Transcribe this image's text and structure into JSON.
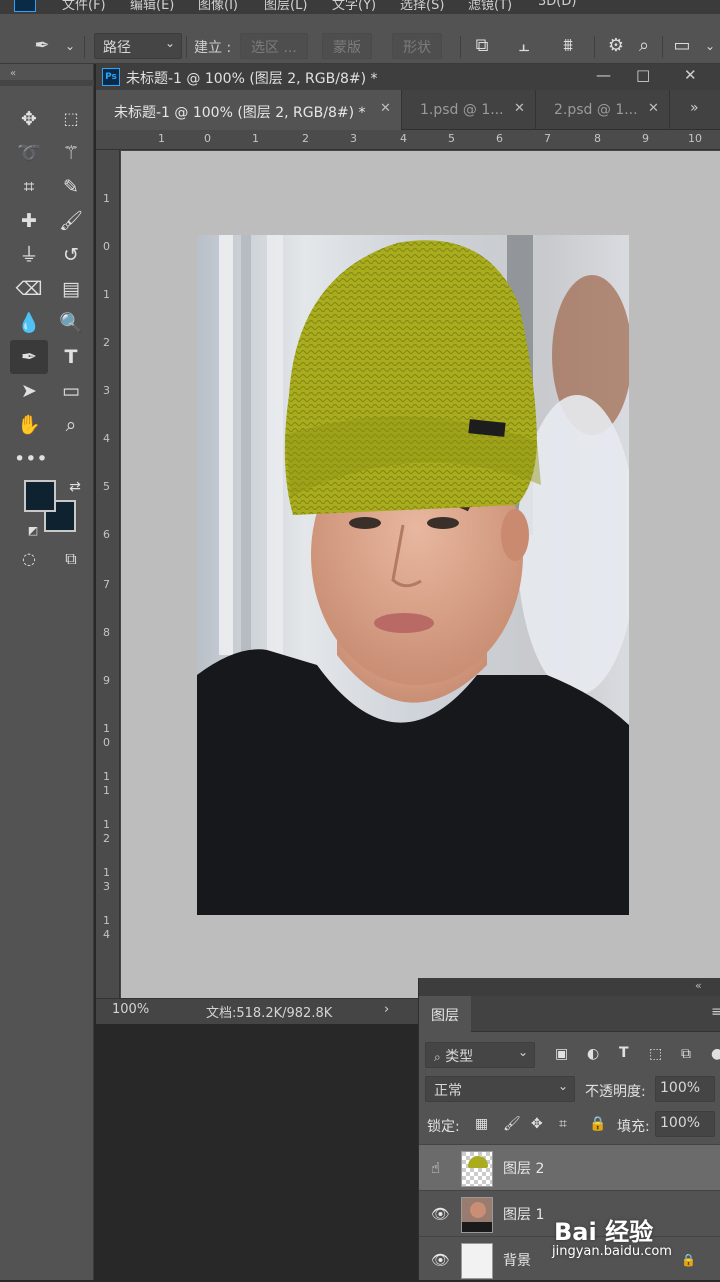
{
  "menu": [
    "文件(F)",
    "编辑(E)",
    "图像(I)",
    "图层(L)",
    "文字(Y)",
    "选择(S)",
    "滤镜(T)",
    "3D(D)"
  ],
  "options": {
    "mode": "路径",
    "make_label": "建立 :",
    "selection_btn": "选区 ...",
    "mask_btn": "蒙版",
    "shape_btn": "形状"
  },
  "document": {
    "title": "未标题-1 @ 100% (图层 2, RGB/8#) *",
    "tabs": [
      {
        "label": "未标题-1 @ 100% (图层 2, RGB/8#) *",
        "active": true
      },
      {
        "label": "1.psd @ 1...",
        "active": false
      },
      {
        "label": "2.psd @ 1...",
        "active": false
      }
    ],
    "hruler": [
      "1",
      "0",
      "1",
      "2",
      "3",
      "4",
      "5",
      "6",
      "7",
      "8",
      "9",
      "10"
    ],
    "vruler": [
      "1",
      "0",
      "1",
      "2",
      "3",
      "4",
      "5",
      "6",
      "7",
      "8",
      "9",
      "1 0",
      "1 1",
      "1 2",
      "1 3",
      "1 4",
      "1 5"
    ],
    "zoom": "100%",
    "doc_info": "文档:518.2K/982.8K"
  },
  "colors": {
    "foreground": "#0f2230",
    "background": "#0f2230",
    "pasteboard": "#bdbdbd",
    "hat": "#a9ad1d"
  },
  "tools": [
    "move-icon",
    "marquee-icon",
    "lasso-icon",
    "magic-wand-icon",
    "crop-icon",
    "eyedropper-icon",
    "healing-brush-icon",
    "brush-icon",
    "stamp-icon",
    "history-brush-icon",
    "eraser-icon",
    "gradient-icon",
    "blur-icon",
    "dodge-icon",
    "pen-icon",
    "type-icon",
    "path-select-icon",
    "rectangle-icon",
    "hand-icon",
    "zoom-icon",
    "more-icon"
  ],
  "layers_panel": {
    "tab": "图层",
    "filter_kind": "类型",
    "blend_mode": "正常",
    "opacity_label": "不透明度:",
    "opacity_value": "100%",
    "lock_label": "锁定:",
    "fill_label": "填充:",
    "fill_value": "100%",
    "layers": [
      {
        "name": "图层 2",
        "selected": true
      },
      {
        "name": "图层 1",
        "selected": false
      },
      {
        "name": "背景",
        "selected": false
      }
    ]
  },
  "watermark": {
    "brand": "Bai 经验",
    "url": "jingyan.baidu.com"
  }
}
